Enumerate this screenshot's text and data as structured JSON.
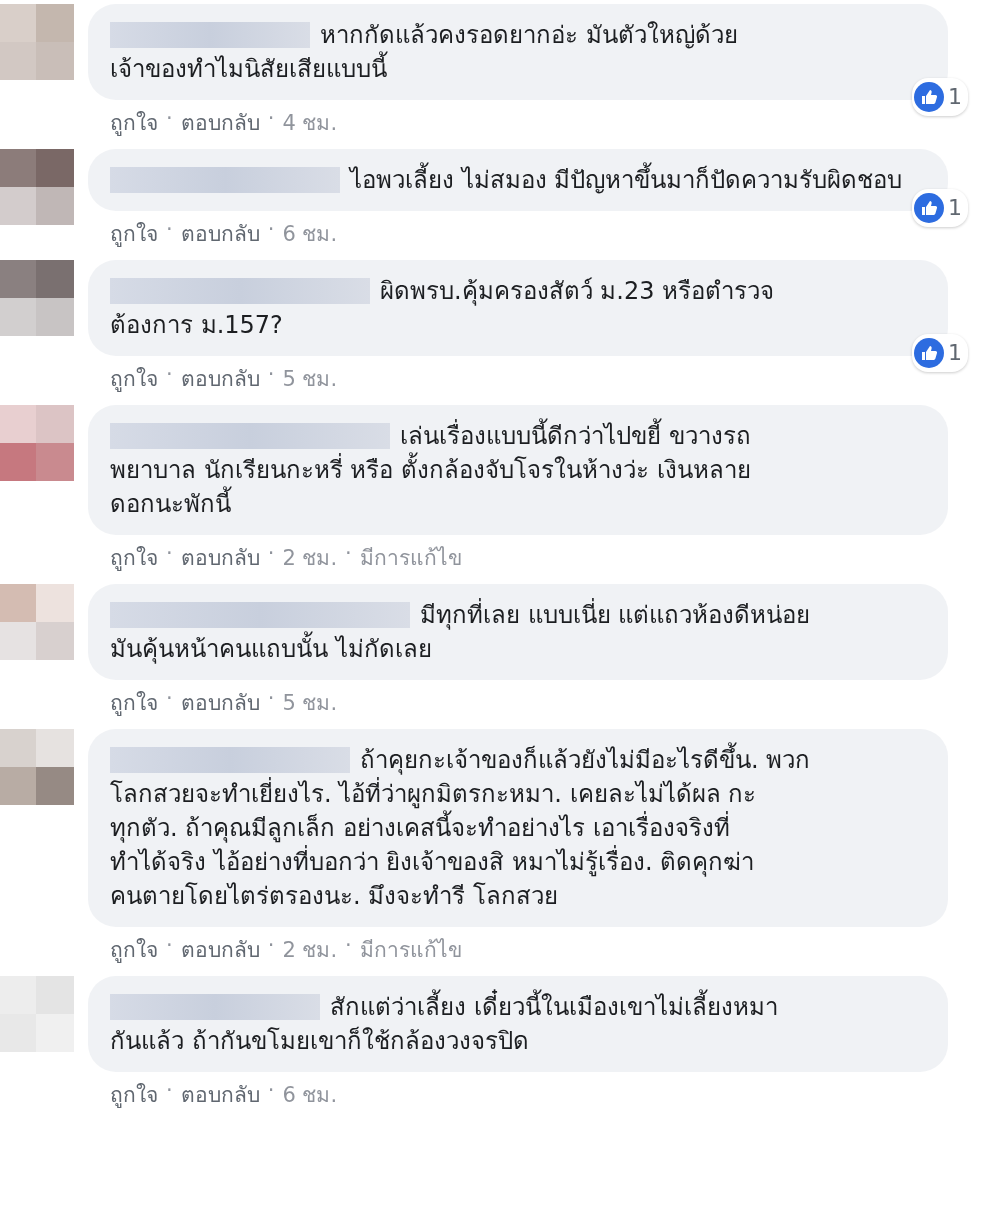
{
  "comments": [
    {
      "text": "หากกัดแล้วคงรอดยากอ่ะ มันตัวใหญ่ด้วย\nเจ้าของทำไมนิสัยเสียแบบนี้",
      "like_count": "1",
      "footer": [
        {
          "kind": "action",
          "text": "ถูกใจ"
        },
        {
          "kind": "dot",
          "text": "·"
        },
        {
          "kind": "action",
          "text": "ตอบกลับ"
        },
        {
          "kind": "dot",
          "text": "·"
        },
        {
          "kind": "time",
          "text": "4 ชม."
        }
      ]
    },
    {
      "text": "ไอพวเลี้ยง ไม่สมอง มีปัญหาขึ้นมาก็ปัดความรับผิดชอบ",
      "like_count": "1",
      "footer": [
        {
          "kind": "action",
          "text": "ถูกใจ"
        },
        {
          "kind": "dot",
          "text": "·"
        },
        {
          "kind": "action",
          "text": "ตอบกลับ"
        },
        {
          "kind": "dot",
          "text": "·"
        },
        {
          "kind": "time",
          "text": "6 ชม."
        }
      ]
    },
    {
      "text": "ผิดพรบ.คุ้มครองสัตว์ ม.23 หรือตำรวจ\nต้องการ ม.157?",
      "like_count": "1",
      "footer": [
        {
          "kind": "action",
          "text": "ถูกใจ"
        },
        {
          "kind": "dot",
          "text": "·"
        },
        {
          "kind": "action",
          "text": "ตอบกลับ"
        },
        {
          "kind": "dot",
          "text": "·"
        },
        {
          "kind": "time",
          "text": "5 ชม."
        }
      ]
    },
    {
      "text": "เล่นเรื่องแบบนี้ดีกว่าไปขยี้ ขวางรถ\nพยาบาล นักเรียนกะหรี่ หรือ ตั้งกล้องจับโจรในห้างว่ะ เงินหลาย\nดอกนะพักนี้",
      "footer": [
        {
          "kind": "action",
          "text": "ถูกใจ"
        },
        {
          "kind": "dot",
          "text": "·"
        },
        {
          "kind": "action",
          "text": "ตอบกลับ"
        },
        {
          "kind": "dot",
          "text": "·"
        },
        {
          "kind": "time",
          "text": "2 ชม."
        },
        {
          "kind": "dot",
          "text": "·"
        },
        {
          "kind": "time",
          "text": "มีการแก้ไข"
        }
      ]
    },
    {
      "text": "มีทุกที่เลย แบบเนี่ย แต่แถวห้องดีหน่อย\nมันคุ้นหน้าคนแถบนั้น ไม่กัดเลย",
      "footer": [
        {
          "kind": "action",
          "text": "ถูกใจ"
        },
        {
          "kind": "dot",
          "text": "·"
        },
        {
          "kind": "action",
          "text": "ตอบกลับ"
        },
        {
          "kind": "dot",
          "text": "·"
        },
        {
          "kind": "time",
          "text": "5 ชม."
        }
      ]
    },
    {
      "text": "ถ้าคุยกะเจ้าของก็แล้วยังไม่มีอะไรดีขึ้น. พวก\nโลกสวยจะทำเยี่ยงไร. ไอ้ที่ว่าผูกมิตรกะหมา. เคยละไม่ได้ผล กะ\nทุกตัว. ถ้าคุณมีลูกเล็ก อย่างเคสนี้จะทำอย่างไร เอาเรื่องจริงที่\nทำได้จริง ไอ้อย่างที่บอกว่า ยิงเจ้าของสิ หมาไม่รู้เรื่อง. ติดคุกฆ่า\nคนตายโดยไตร่ตรองนะ. มึงจะทำรี โลกสวย",
      "footer": [
        {
          "kind": "action",
          "text": "ถูกใจ"
        },
        {
          "kind": "dot",
          "text": "·"
        },
        {
          "kind": "action",
          "text": "ตอบกลับ"
        },
        {
          "kind": "dot",
          "text": "·"
        },
        {
          "kind": "time",
          "text": "2 ชม."
        },
        {
          "kind": "dot",
          "text": "·"
        },
        {
          "kind": "time",
          "text": "มีการแก้ไข"
        }
      ]
    },
    {
      "text": "สักแต่ว่าเลี้ยง เดี๋ยวนี้ในเมืองเขาไม่เลี้ยงหมา\nกันแล้ว ถ้ากันขโมยเขาก็ใช้กล้องวงจรปิด",
      "footer": [
        {
          "kind": "action",
          "text": "ถูกใจ"
        },
        {
          "kind": "dot",
          "text": "·"
        },
        {
          "kind": "action",
          "text": "ตอบกลับ"
        },
        {
          "kind": "dot",
          "text": "·"
        },
        {
          "kind": "time",
          "text": "6 ชม."
        }
      ]
    }
  ]
}
